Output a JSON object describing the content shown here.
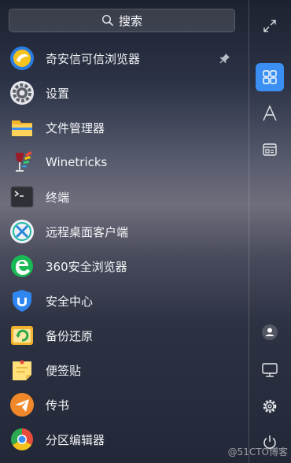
{
  "search": {
    "label": "搜索",
    "icon": "search-icon"
  },
  "apps": [
    {
      "label": "奇安信可信浏览器",
      "icon": "qianxin-browser-icon",
      "pinned": true
    },
    {
      "label": "设置",
      "icon": "settings-gear-icon"
    },
    {
      "label": "文件管理器",
      "icon": "folder-icon"
    },
    {
      "label": "Winetricks",
      "icon": "winetricks-icon"
    },
    {
      "label": "终端",
      "icon": "terminal-icon"
    },
    {
      "label": "远程桌面客户端",
      "icon": "remote-desktop-icon"
    },
    {
      "label": "360安全浏览器",
      "icon": "360-browser-icon"
    },
    {
      "label": "安全中心",
      "icon": "security-shield-icon"
    },
    {
      "label": "备份还原",
      "icon": "backup-restore-icon"
    },
    {
      "label": "便签贴",
      "icon": "sticky-note-icon"
    },
    {
      "label": "传书",
      "icon": "paper-plane-icon"
    },
    {
      "label": "分区编辑器",
      "icon": "partition-editor-icon"
    }
  ],
  "sidebar": {
    "buttons": [
      "expand-icon",
      "grid-view-icon",
      "letter-a-icon",
      "category-icon",
      "user-icon",
      "computer-icon",
      "settings-icon",
      "power-icon"
    ],
    "active": "grid-view-icon"
  },
  "watermark": "@51CTO博客",
  "colors": {
    "accent": "#3b8ff2"
  }
}
